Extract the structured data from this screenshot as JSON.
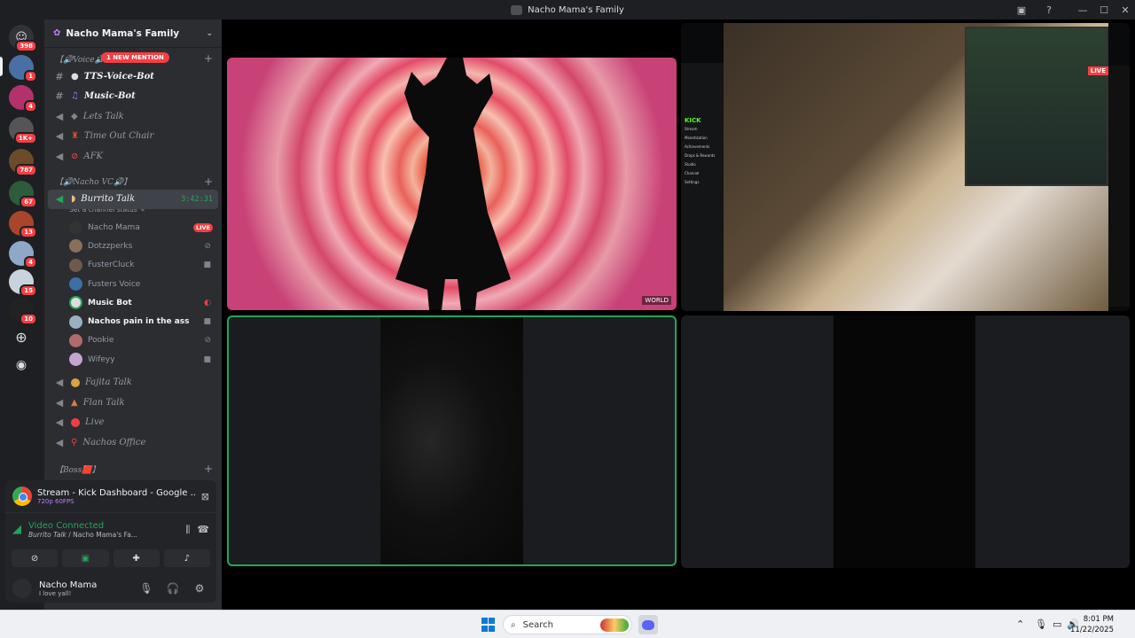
{
  "window": {
    "title": "Nacho Mama's Family",
    "minimize": "—",
    "maximize": "☐",
    "close": "✕"
  },
  "servers": [
    {
      "badge": "398"
    },
    {
      "badge": "1"
    },
    {
      "badge": "4"
    },
    {
      "badge": "1K+"
    },
    {
      "badge": "787"
    },
    {
      "badge": "67"
    },
    {
      "badge": "13"
    },
    {
      "badge": "4"
    },
    {
      "badge": "15"
    },
    {
      "badge": "10"
    }
  ],
  "server_header": {
    "name": "Nacho Mama's Family"
  },
  "mention_pill": "1 NEW MENTION",
  "categories": {
    "voice": "【🔊Voice🔊",
    "nacho_vc": "【🔊Nacho VC🔊】",
    "boss": "【Boss🟥】"
  },
  "channels_top": [
    {
      "label": "TTS-Voice-Bot"
    },
    {
      "label": "Music-Bot"
    },
    {
      "label": "Lets Talk"
    },
    {
      "label": "Time Out Chair"
    },
    {
      "label": "AFK"
    }
  ],
  "active_channel": {
    "label": "Burrito Talk",
    "timer": "3:42:31",
    "status": "Set a channel status ✎"
  },
  "voice_users": [
    {
      "name": "Nacho Mama",
      "live": "LIVE"
    },
    {
      "name": "Dotzzperks"
    },
    {
      "name": "FusterCluck"
    },
    {
      "name": "Fusters Voice"
    },
    {
      "name": "Music Bot"
    },
    {
      "name": "Nachos pain in the ass"
    },
    {
      "name": "Pookie"
    },
    {
      "name": "Wifeyy"
    }
  ],
  "channels_bottom": [
    {
      "label": "Fajita Talk"
    },
    {
      "label": "Flan Talk"
    },
    {
      "label": "Live"
    },
    {
      "label": "Nachos Office"
    }
  ],
  "stream": {
    "title": "Stream - Kick Dashboard - Google ...",
    "quality": "720p 60FPS"
  },
  "voice_connection": {
    "status": "Video Connected",
    "location_channel": "Burrito Talk",
    "location_server": " / Nacho Mama's Fa..."
  },
  "user": {
    "name": "Nacho Mama",
    "status": "I love yall!"
  },
  "tiles": {
    "world_tag": "WORLD",
    "live_badge": "LIVE",
    "kick_logo": "KICK",
    "kick_menu": [
      "Stream",
      "Monetization",
      "Achievements",
      "Drops & Rewards",
      "Studio",
      "Channel",
      "Settings"
    ]
  },
  "taskbar": {
    "search_placeholder": "Search",
    "time": "8:01 PM",
    "date": "11/22/2025"
  }
}
